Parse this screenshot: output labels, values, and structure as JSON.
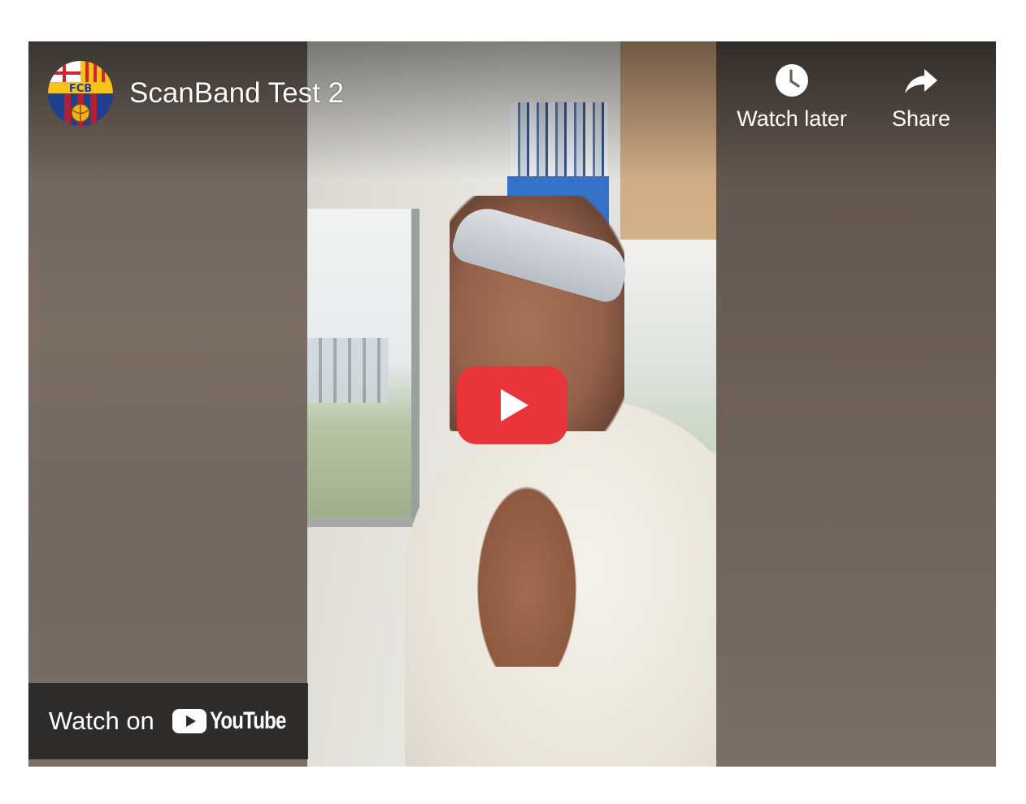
{
  "video": {
    "title": "ScanBand Test 2",
    "channel_avatar_text": "FCB"
  },
  "actions": {
    "watch_later_label": "Watch later",
    "share_label": "Share"
  },
  "watch_on": {
    "label": "Watch on",
    "brand": "YouTube"
  },
  "colors": {
    "play_button": "#e8343a",
    "overlay_dark": "#212121",
    "text": "#ffffff"
  },
  "icons": {
    "watch_later": "clock-icon",
    "share": "share-arrow-icon",
    "play": "play-icon",
    "youtube": "youtube-logo-icon"
  }
}
